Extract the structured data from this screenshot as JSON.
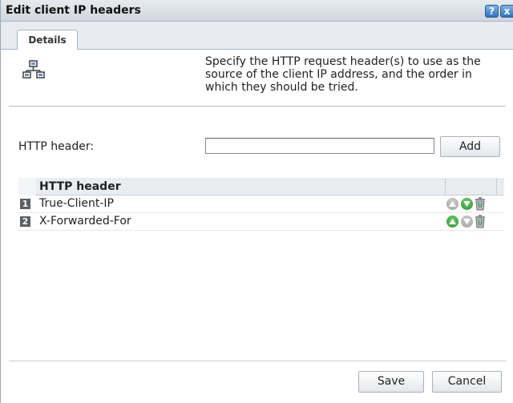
{
  "dialog": {
    "title": "Edit client IP headers",
    "help_icon": "?",
    "close_icon": "x"
  },
  "tabs": [
    {
      "label": "Details",
      "active": true
    }
  ],
  "description": "Specify the HTTP request header(s) to use as the source of the client IP address, and the order in which they should be tried.",
  "form": {
    "header_label": "HTTP header:",
    "header_value": "",
    "add_label": "Add"
  },
  "table": {
    "column_header": "HTTP header",
    "rows": [
      {
        "index": "1",
        "value": "True-Client-IP",
        "up_enabled": false,
        "down_enabled": true
      },
      {
        "index": "2",
        "value": "X-Forwarded-For",
        "up_enabled": true,
        "down_enabled": false
      }
    ]
  },
  "footer": {
    "save_label": "Save",
    "cancel_label": "Cancel"
  },
  "colors": {
    "accent_blue": "#2f74bd",
    "enabled_green": "#2b8f2b",
    "disabled_gray": "#9a9a9a"
  },
  "icons": [
    "network-icon",
    "help-icon",
    "close-icon",
    "move-up-icon",
    "move-down-icon",
    "trash-icon"
  ]
}
